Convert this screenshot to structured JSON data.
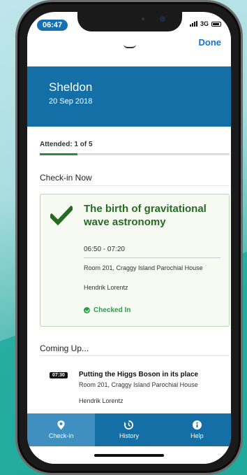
{
  "status_bar": {
    "time": "06:47",
    "network": "3G"
  },
  "nav": {
    "done_label": "Done"
  },
  "header": {
    "name": "Sheldon",
    "date": "20 Sep 2018",
    "bg_color": "#136fa6"
  },
  "attendance": {
    "label": "Attended: 1 of 5",
    "progress_fraction": 0.2
  },
  "checkin_now": {
    "section_title": "Check-in Now",
    "title": "The birth of gravitational wave astronomy",
    "time": "06:50 - 07:20",
    "room": "Room 201, Craggy Island Parochial House",
    "speaker": "Hendrik Lorentz",
    "status": "Checked In",
    "status_color": "#2aa144"
  },
  "coming_up": {
    "section_title": "Coming Up...",
    "items": [
      {
        "time": "07:30",
        "title": "Putting the Higgs Boson in its place",
        "room": "Room 201, Craggy Island Parochial House",
        "speaker": "Hendrik Lorentz"
      }
    ]
  },
  "tabs": [
    {
      "label": "Check-in",
      "icon": "location-pin-icon",
      "active": true
    },
    {
      "label": "History",
      "icon": "history-icon",
      "active": false
    },
    {
      "label": "Help",
      "icon": "info-icon",
      "active": false
    }
  ]
}
